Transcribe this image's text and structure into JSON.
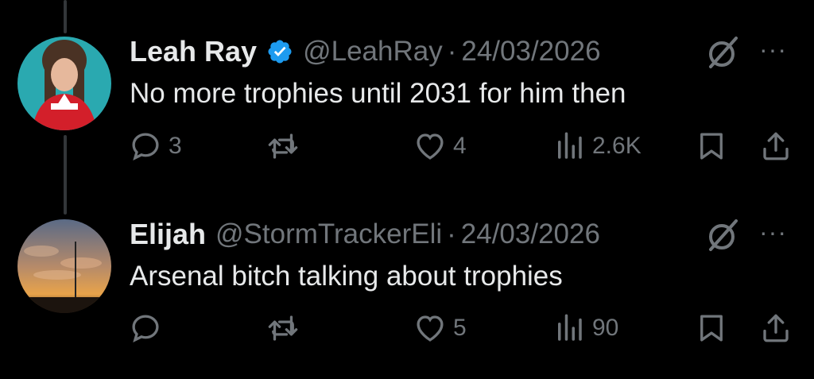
{
  "tweets": [
    {
      "name": "Leah Ray",
      "verified": true,
      "handle": "@LeahRay",
      "separator": "·",
      "date": "24/03/2026",
      "text": "No more trophies until 2031 for him then",
      "replies": "3",
      "retweets": "",
      "likes": "4",
      "views": "2.6K",
      "avatar_icon": "woman-in-arsenal-shirt"
    },
    {
      "name": "Elijah",
      "verified": false,
      "handle": "@StormTrackerEli",
      "separator": "·",
      "date": "24/03/2026",
      "text": "Arsenal bitch talking about trophies",
      "replies": "",
      "retweets": "",
      "likes": "5",
      "views": "90",
      "avatar_icon": "sunset-sky-photo"
    }
  ],
  "more_label": "···",
  "colors": {
    "background": "#000000",
    "text": "#e7e9ea",
    "muted": "#71767b",
    "verified": "#1d9bf0"
  }
}
